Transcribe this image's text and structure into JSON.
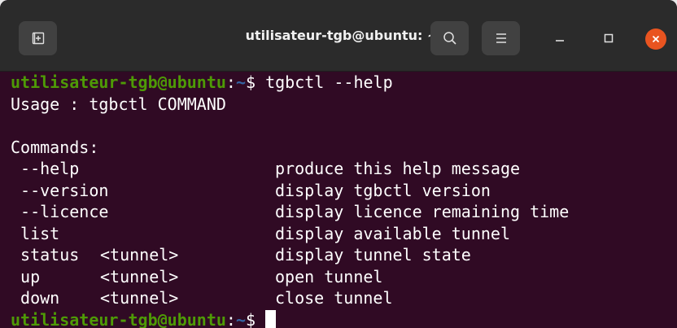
{
  "window": {
    "title": "utilisateur-tgb@ubuntu: ~"
  },
  "icons": {
    "new_tab": "new-tab-icon",
    "search": "search-icon",
    "menu": "hamburger-menu-icon",
    "minimize": "minimize-icon",
    "maximize": "maximize-icon",
    "close": "close-icon"
  },
  "colors": {
    "terminal_bg": "#300a24",
    "prompt_user": "#4e9a06",
    "prompt_path": "#3465a4",
    "close_button": "#e95420"
  },
  "prompt": {
    "user_host": "utilisateur-tgb@ubuntu",
    "sep": ":",
    "path": "~",
    "symbol": "$ "
  },
  "command": "tgbctl --help",
  "usage_line": "Usage : tgbctl COMMAND",
  "commands_header": "Commands:",
  "commands": [
    {
      "name": " --help",
      "args": "",
      "desc": "produce this help message"
    },
    {
      "name": " --version",
      "args": "",
      "desc": "display tgbctl version"
    },
    {
      "name": " --licence",
      "args": "",
      "desc": "display licence remaining time"
    },
    {
      "name": " list",
      "args": "",
      "desc": "display available tunnel"
    },
    {
      "name": " status",
      "args": "<tunnel>",
      "desc": "display tunnel state"
    },
    {
      "name": " up",
      "args": "<tunnel>",
      "desc": "open tunnel"
    },
    {
      "name": " down",
      "args": "<tunnel>",
      "desc": "close tunnel"
    }
  ]
}
